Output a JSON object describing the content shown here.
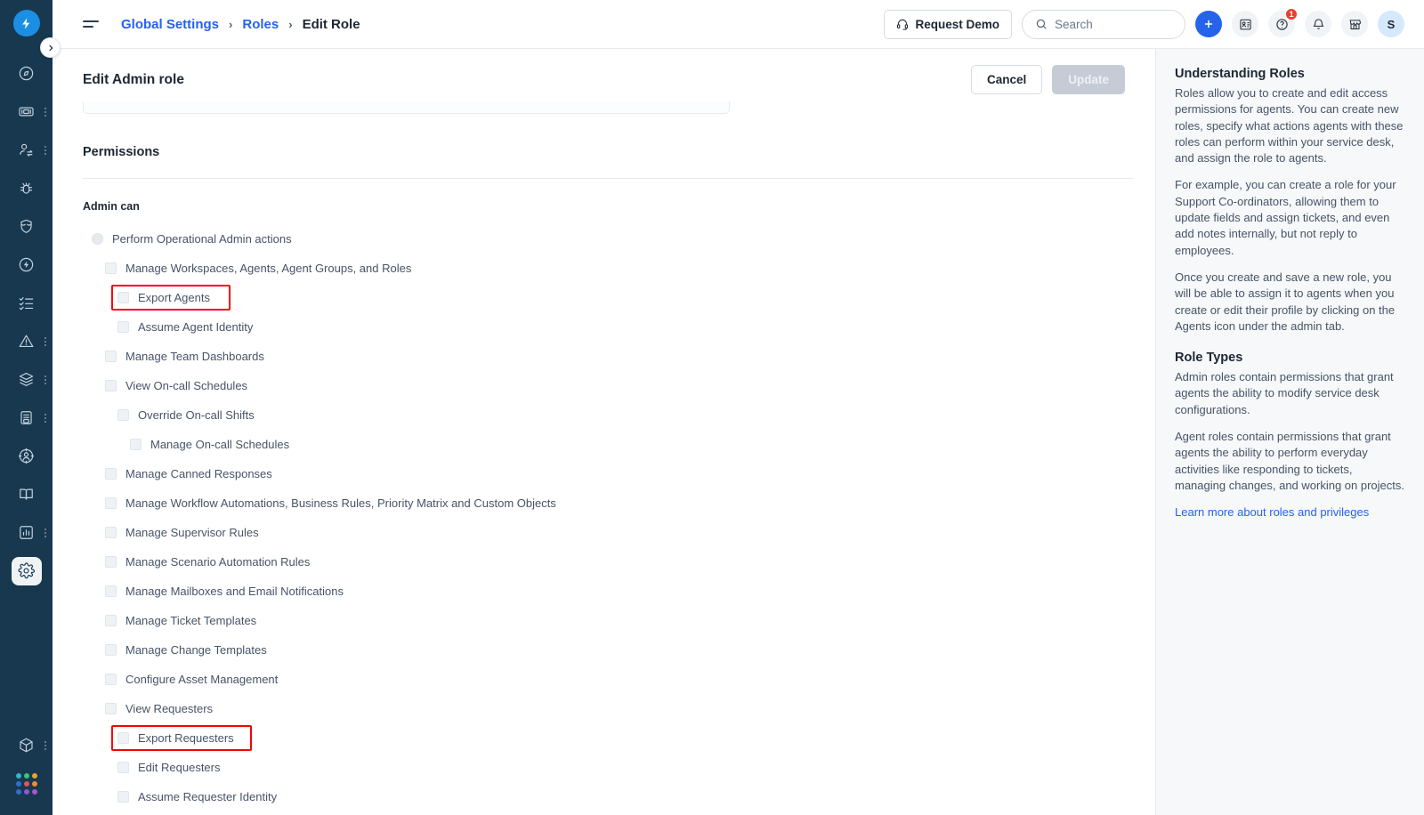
{
  "brand": {
    "logo_icon": "lightning-bolt-logo",
    "accent": "#2563eb",
    "rail_bg": "#17384f",
    "highlight": "#fb0007"
  },
  "topbar": {
    "hamburger_icon": "hamburger-menu-icon",
    "breadcrumb": [
      {
        "label": "Global Settings",
        "current": false
      },
      {
        "label": "Roles",
        "current": false
      },
      {
        "label": "Edit Role",
        "current": true
      }
    ],
    "breadcrumb_separator": "›",
    "request_demo_label": "Request Demo",
    "request_demo_icon": "headset-icon",
    "search": {
      "placeholder": "Search",
      "value": "",
      "icon": "search-icon"
    },
    "add_button_icon": "plus-icon",
    "icons": [
      {
        "name": "contact-card-icon",
        "badge": ""
      },
      {
        "name": "help-question-icon",
        "badge": "1"
      },
      {
        "name": "notification-bell-icon",
        "badge": ""
      },
      {
        "name": "marketplace-shop-icon",
        "badge": ""
      }
    ],
    "avatar_initial": "S"
  },
  "rail": {
    "collapse_icon": "chevron-right-icon",
    "items": [
      {
        "name": "sidebar-item-dashboard",
        "icon": "compass-dashboard-icon",
        "kebab": false,
        "active": false
      },
      {
        "name": "sidebar-item-tickets",
        "icon": "ticket-icon",
        "kebab": true,
        "active": false
      },
      {
        "name": "sidebar-item-agents",
        "icon": "user-switch-icon",
        "kebab": true,
        "active": false
      },
      {
        "name": "sidebar-item-problems",
        "icon": "bug-icon",
        "kebab": false,
        "active": false
      },
      {
        "name": "sidebar-item-changes",
        "icon": "shield-icon",
        "kebab": false,
        "active": false
      },
      {
        "name": "sidebar-item-releases",
        "icon": "flash-circle-icon",
        "kebab": false,
        "active": false
      },
      {
        "name": "sidebar-item-tasks",
        "icon": "checklist-icon",
        "kebab": false,
        "active": false
      },
      {
        "name": "sidebar-item-alerts",
        "icon": "alert-triangle-icon",
        "kebab": true,
        "active": false
      },
      {
        "name": "sidebar-item-assets",
        "icon": "layers-icon",
        "kebab": true,
        "active": false
      },
      {
        "name": "sidebar-item-contracts",
        "icon": "document-archive-icon",
        "kebab": true,
        "active": false
      },
      {
        "name": "sidebar-item-requesters",
        "icon": "person-target-icon",
        "kebab": false,
        "active": false
      },
      {
        "name": "sidebar-item-knowledge",
        "icon": "book-icon",
        "kebab": false,
        "active": false
      },
      {
        "name": "sidebar-item-analytics",
        "icon": "bar-chart-icon",
        "kebab": true,
        "active": false
      },
      {
        "name": "sidebar-item-admin",
        "icon": "gear-icon",
        "kebab": false,
        "active": true
      }
    ],
    "bottom_items": [
      {
        "name": "sidebar-item-marketplace",
        "icon": "cube-icon",
        "kebab": true
      },
      {
        "name": "sidebar-item-app-switcher",
        "icon": "color-dot-grid-icon",
        "kebab": false
      }
    ],
    "dot_colors": [
      "#33b6c4",
      "#3cc27a",
      "#f0a22e",
      "#2f6fd0",
      "#e05454",
      "#ef8b32",
      "#2f6fd0",
      "#8a5ad4",
      "#a855c9"
    ]
  },
  "page": {
    "title": "Edit Admin role",
    "cancel_label": "Cancel",
    "update_label": "Update",
    "permissions_heading": "Permissions",
    "admin_can_heading": "Admin can"
  },
  "permissions": [
    {
      "label": "Perform Operational Admin actions",
      "control": "radio",
      "indent": 0,
      "highlight": false,
      "hl_width": 0
    },
    {
      "label": "Manage Workspaces, Agents, Agent Groups, and Roles",
      "control": "checkbox",
      "indent": 1,
      "highlight": false,
      "hl_width": 0
    },
    {
      "label": "Export Agents",
      "control": "checkbox",
      "indent": 2,
      "highlight": true,
      "hl_width": 134
    },
    {
      "label": "Assume Agent Identity",
      "control": "checkbox",
      "indent": 2,
      "highlight": false,
      "hl_width": 0
    },
    {
      "label": "Manage Team Dashboards",
      "control": "checkbox",
      "indent": 1,
      "highlight": false,
      "hl_width": 0
    },
    {
      "label": "View On-call Schedules",
      "control": "checkbox",
      "indent": 1,
      "highlight": false,
      "hl_width": 0
    },
    {
      "label": "Override On-call Shifts",
      "control": "checkbox",
      "indent": 2,
      "highlight": false,
      "hl_width": 0
    },
    {
      "label": "Manage On-call Schedules",
      "control": "checkbox",
      "indent": 3,
      "highlight": false,
      "hl_width": 0
    },
    {
      "label": "Manage Canned Responses",
      "control": "checkbox",
      "indent": 1,
      "highlight": false,
      "hl_width": 0
    },
    {
      "label": "Manage Workflow Automations, Business Rules, Priority Matrix and Custom Objects",
      "control": "checkbox",
      "indent": 1,
      "highlight": false,
      "hl_width": 0
    },
    {
      "label": "Manage Supervisor Rules",
      "control": "checkbox",
      "indent": 1,
      "highlight": false,
      "hl_width": 0
    },
    {
      "label": "Manage Scenario Automation Rules",
      "control": "checkbox",
      "indent": 1,
      "highlight": false,
      "hl_width": 0
    },
    {
      "label": "Manage Mailboxes and Email Notifications",
      "control": "checkbox",
      "indent": 1,
      "highlight": false,
      "hl_width": 0
    },
    {
      "label": "Manage Ticket Templates",
      "control": "checkbox",
      "indent": 1,
      "highlight": false,
      "hl_width": 0
    },
    {
      "label": "Manage Change Templates",
      "control": "checkbox",
      "indent": 1,
      "highlight": false,
      "hl_width": 0
    },
    {
      "label": "Configure Asset Management",
      "control": "checkbox",
      "indent": 1,
      "highlight": false,
      "hl_width": 0
    },
    {
      "label": "View Requesters",
      "control": "checkbox",
      "indent": 1,
      "highlight": false,
      "hl_width": 0
    },
    {
      "label": "Export Requesters",
      "control": "checkbox",
      "indent": 2,
      "highlight": true,
      "hl_width": 158
    },
    {
      "label": "Edit Requesters",
      "control": "checkbox",
      "indent": 2,
      "highlight": false,
      "hl_width": 0
    },
    {
      "label": "Assume Requester Identity",
      "control": "checkbox",
      "indent": 2,
      "highlight": false,
      "hl_width": 0
    }
  ],
  "helper": {
    "title": "Understanding Roles",
    "paragraphs": [
      "Roles allow you to create and edit access permissions for agents. You can create new roles, specify what actions agents with these roles can perform within your service desk, and assign the role to agents.",
      "For example, you can create a role for your Support Co-ordinators, allowing them to update fields and assign tickets, and even add notes internally, but not reply to employees.",
      "Once you create and save a new role, you will be able to assign it to agents when you create or edit their profile by clicking on the Agents icon under the admin tab."
    ],
    "title2": "Role Types",
    "paragraphs2": [
      "Admin roles contain permissions that grant agents the ability to modify service desk configurations.",
      "Agent roles contain permissions that grant agents the ability to perform everyday activities like responding to tickets, managing changes, and working on projects."
    ],
    "link_label": "Learn more about roles and privileges"
  }
}
